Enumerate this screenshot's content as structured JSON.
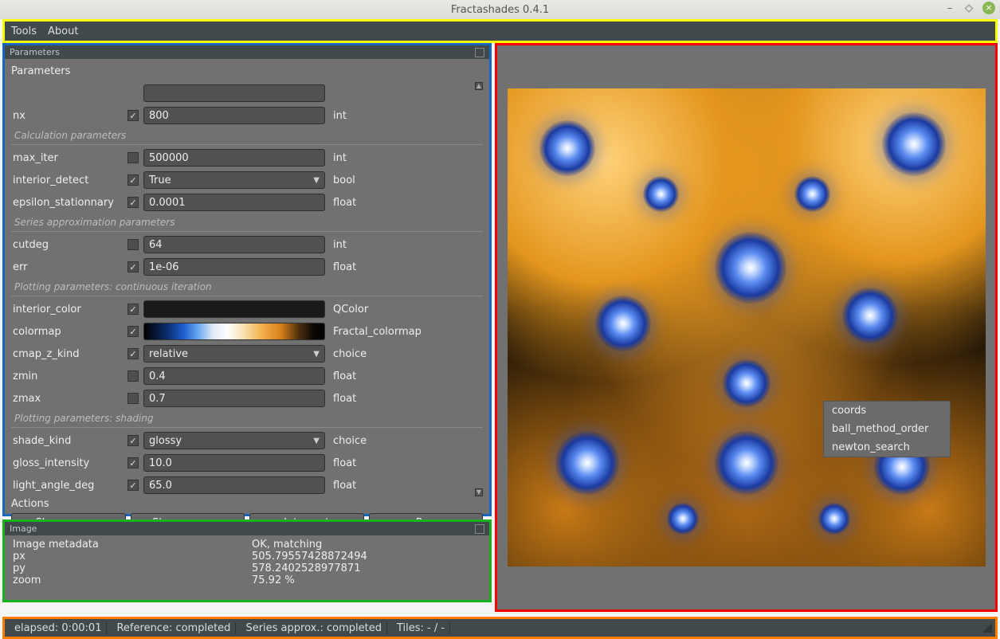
{
  "window": {
    "title": "Fractashades 0.4.1"
  },
  "menu": {
    "tools": "Tools",
    "about": "About"
  },
  "params_panel": {
    "dock_title": "Parameters",
    "heading": "Parameters",
    "groups": {
      "calc": "Calculation parameters",
      "series": "Series approximation parameters",
      "plot_ci": "Plotting parameters: continuous iteration",
      "plot_sh": "Plotting parameters: shading"
    },
    "rows": {
      "nx": {
        "label": "nx",
        "checked": true,
        "value": "800",
        "type": "int"
      },
      "max_iter": {
        "label": "max_iter",
        "checked": false,
        "value": "500000",
        "type": "int"
      },
      "interior_detect": {
        "label": "interior_detect",
        "checked": true,
        "value": "True",
        "type": "bool",
        "dropdown": true
      },
      "epsilon_stationnary": {
        "label": "epsilon_stationnary",
        "checked": true,
        "value": "0.0001",
        "type": "float"
      },
      "cutdeg": {
        "label": "cutdeg",
        "checked": false,
        "value": "64",
        "type": "int"
      },
      "err": {
        "label": "err",
        "checked": true,
        "value": "1e-06",
        "type": "float"
      },
      "interior_color": {
        "label": "interior_color",
        "checked": true,
        "value": "",
        "type": "QColor"
      },
      "colormap": {
        "label": "colormap",
        "checked": true,
        "value": "",
        "type": "Fractal_colormap"
      },
      "cmap_z_kind": {
        "label": "cmap_z_kind",
        "checked": true,
        "value": "relative",
        "type": "choice",
        "dropdown": true
      },
      "zmin": {
        "label": "zmin",
        "checked": false,
        "value": "0.4",
        "type": "float"
      },
      "zmax": {
        "label": "zmax",
        "checked": false,
        "value": "0.7",
        "type": "float"
      },
      "shade_kind": {
        "label": "shade_kind",
        "checked": true,
        "value": "glossy",
        "type": "choice",
        "dropdown": true
      },
      "gloss_intensity": {
        "label": "gloss_intensity",
        "checked": true,
        "value": "10.0",
        "type": "float"
      },
      "light_angle_deg": {
        "label": "light_angle_deg",
        "checked": true,
        "value": "65.0",
        "type": "float"
      }
    },
    "actions_label": "Actions",
    "actions": {
      "show_source": "Show source",
      "show_params": "Show params",
      "interrupt": "Interrupt",
      "run": "Run"
    }
  },
  "image_panel": {
    "dock_title": "Image",
    "meta": {
      "label": "Image metadata",
      "status": "OK, matching",
      "px_label": "px",
      "px": "505.79557428872494",
      "py_label": "py",
      "py": "578.2402528977871",
      "zoom_label": "zoom",
      "zoom": "75.92 %"
    }
  },
  "context_menu": {
    "coords": "coords",
    "ball_method_order": "ball_method_order",
    "newton_search": "newton_search"
  },
  "status": {
    "elapsed": "elapsed: 0:00:01",
    "reference": "Reference: completed",
    "series": "Series approx.: completed",
    "tiles": "Tiles: - / -"
  }
}
